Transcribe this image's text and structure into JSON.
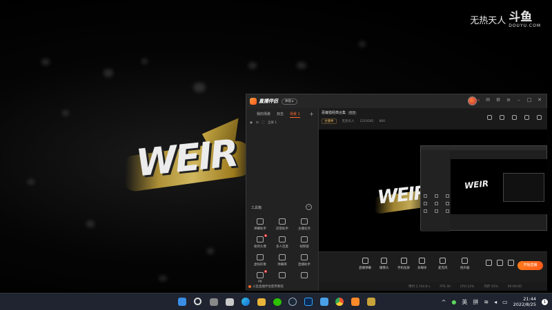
{
  "watermark": {
    "text": "无热天人",
    "logo": "斗鱼",
    "sub": "DOUYU.COM"
  },
  "app": {
    "name": "直播伴侣",
    "badge": "体验 ▸",
    "scene_tabs": [
      "我的场景",
      "双击",
      "场景 1"
    ],
    "scene_item": "全屏 1",
    "toolbox_title": "工具箱",
    "tools": [
      {
        "label": "弹幕助手",
        "new": false
      },
      {
        "label": "房管助手",
        "new": false
      },
      {
        "label": "主播任务",
        "new": false
      },
      {
        "label": "收到头像",
        "new": true
      },
      {
        "label": "多人连麦",
        "new": false
      },
      {
        "label": "视频窗",
        "new": false
      },
      {
        "label": "虚拟形象",
        "new": false
      },
      {
        "label": "弹幕库",
        "new": false
      },
      {
        "label": "直播助手",
        "new": false
      },
      {
        "label": "PK",
        "new": true
      },
      {
        "label": "",
        "new": false
      },
      {
        "label": "",
        "new": false
      }
    ],
    "footer": "斗鱼直播伴侣使用教程",
    "stream_title": "恶魔猎经典合集",
    "stream_edit": "修改",
    "stream_meta": {
      "category": "主播秀",
      "user": "无热天人",
      "room": "1219285",
      "fans": "866"
    },
    "dock": [
      "直播弹幕",
      "摄像头",
      "手机投屏",
      "多媒体",
      "麦克风",
      "扬声器"
    ],
    "start_live": "开始直播",
    "status": [
      "用时 2,744.8 s",
      "FPS 30",
      "CPU 12%",
      "内存 55%",
      "00:00:00"
    ]
  },
  "taskbar": {
    "lang": "英",
    "ime": "拼",
    "time": "21:44",
    "date": "2022/8/25",
    "notif": "1"
  }
}
